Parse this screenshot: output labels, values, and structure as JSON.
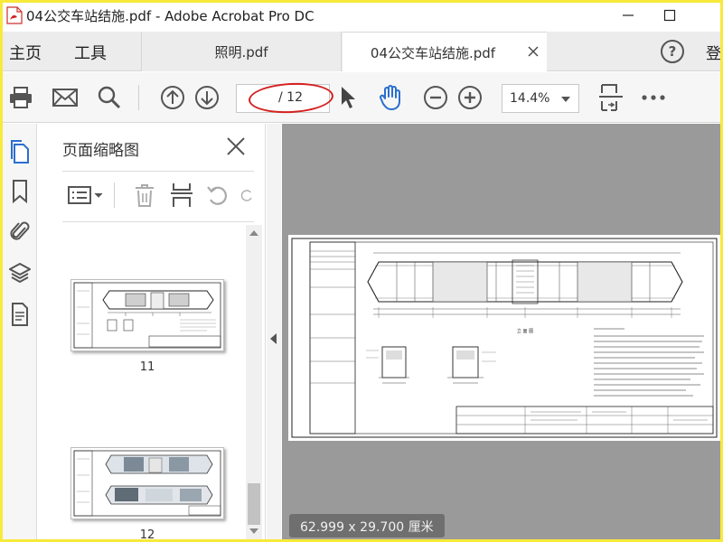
{
  "window": {
    "title": "04公交车站结施.pdf - Adobe Acrobat Pro DC"
  },
  "nav": {
    "home": "主页",
    "tools": "工具"
  },
  "tabs": [
    {
      "label": "照明.pdf",
      "active": false
    },
    {
      "label": "04公交车站结施.pdf",
      "active": true
    }
  ],
  "header": {
    "help": "?",
    "signin": "登"
  },
  "toolbar": {
    "icons": [
      "print-icon",
      "email-icon",
      "search-icon",
      "page-up-icon",
      "page-down-icon",
      "select-cursor-icon",
      "hand-icon",
      "zoom-out-icon",
      "zoom-in-icon",
      "fit-page-icon",
      "more-icon"
    ],
    "page_current": "",
    "page_total": "/ 12",
    "zoom": "14.4%"
  },
  "rail": {
    "icons": [
      "pages-icon",
      "bookmark-icon",
      "attachment-icon",
      "layers-icon",
      "document-icon"
    ]
  },
  "thumbnails_panel": {
    "title": "页面缩略图",
    "tools": [
      "options-menu-icon",
      "delete-icon",
      "insert-page-icon",
      "rotate-ccw-icon",
      "rotate-cw-icon"
    ],
    "pages": [
      {
        "label": "11"
      },
      {
        "label": "12"
      }
    ]
  },
  "document": {
    "page_size": "62.999 x 29.700 厘米"
  },
  "colors": {
    "screenshot_border": "#f7ea3a",
    "annotation_ellipse": "#d52020",
    "active_rail_icon": "#2b6fce",
    "hand_tool": "#2b6fce",
    "doc_background": "#9a9a9a"
  }
}
